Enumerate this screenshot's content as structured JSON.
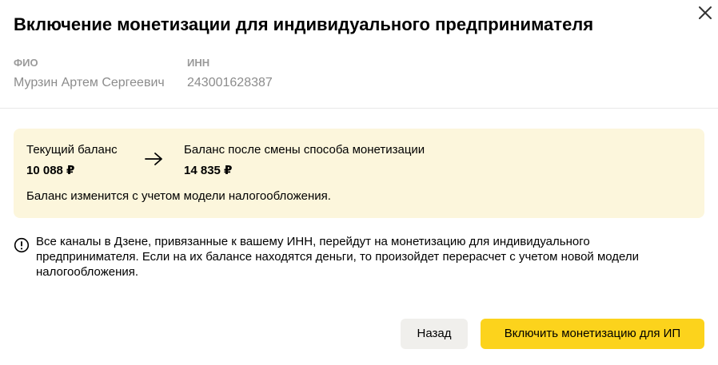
{
  "dialog": {
    "title": "Включение монетизации для индивидуального предпринимателя"
  },
  "person": {
    "fio_label": "ФИО",
    "fio_value": "Мурзин Артем Сергеевич",
    "inn_label": "ИНН",
    "inn_value": "243001628387"
  },
  "balance": {
    "current_label": "Текущий баланс",
    "current_amount": "10 088 ₽",
    "after_label": "Баланс после смены способа монетизации",
    "after_amount": "14 835 ₽",
    "note": "Баланс изменится с учетом модели налогообложения.",
    "background_color": "#fcf6dc"
  },
  "info": {
    "text": "Все каналы в Дзене, привязанные к вашему ИНН, перейдут на монетизацию для индивидуального предпринимателя. Если на их балансе находятся деньги, то произойдет перерасчет с учетом новой модели налогообложения."
  },
  "buttons": {
    "back_label": "Назад",
    "enable_label": "Включить монетизацию для ИП",
    "primary_color": "#fcd31c",
    "secondary_color": "#f0efec"
  },
  "icons": {
    "close": "close-icon",
    "arrow": "arrow-right-icon",
    "info": "exclamation-circle-icon"
  }
}
